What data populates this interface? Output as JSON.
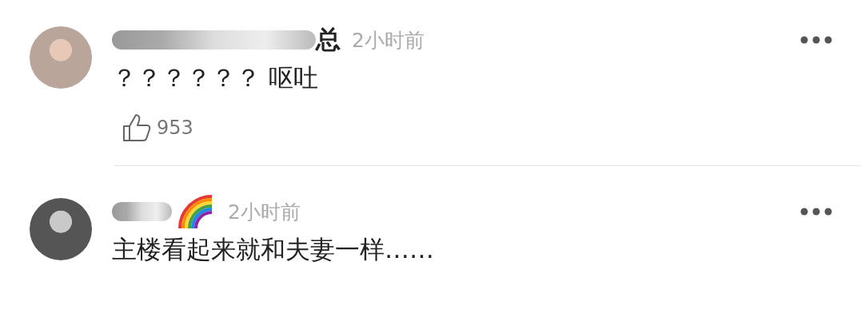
{
  "comments": [
    {
      "kind": "plain",
      "author_visible": "总",
      "redacted": true,
      "time": "2小时前",
      "text": "？？？？？？ 呕吐",
      "likes": "953"
    },
    {
      "kind": "emoji",
      "redacted": true,
      "time": "2小时前",
      "text": "主楼看起来就和夫妻一样……"
    }
  ]
}
